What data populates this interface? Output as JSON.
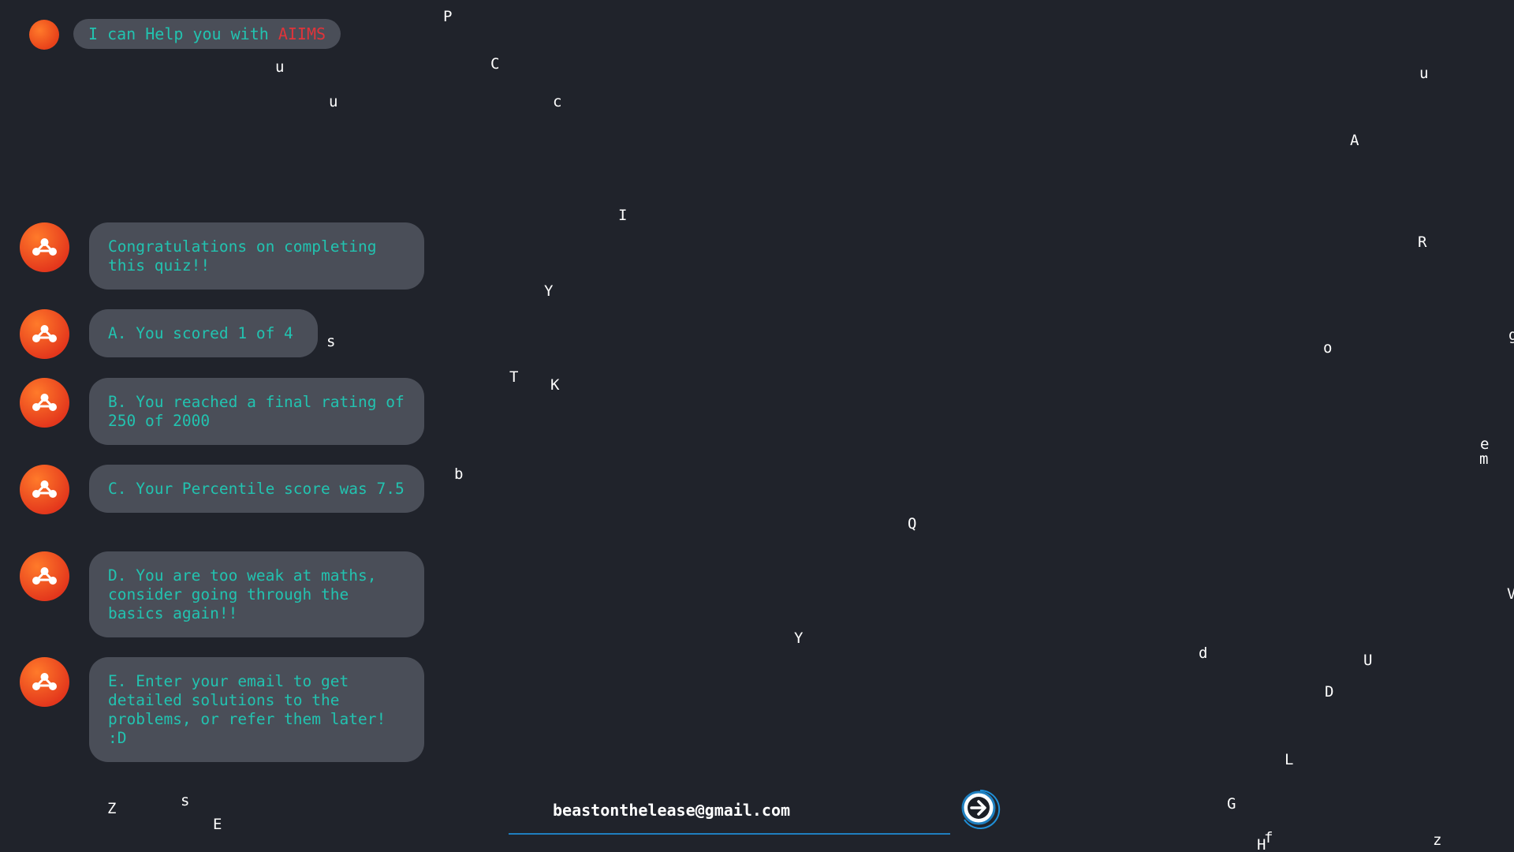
{
  "header": {
    "label_prefix": "I can Help you with ",
    "label_highlight": "AIIMS"
  },
  "messages": [
    {
      "text": "Congratulations on completing this quiz!!"
    },
    {
      "text": "A. You scored 1 of 4"
    },
    {
      "text": "B. You reached a final rating of 250 of 2000"
    },
    {
      "text": "C. Your Percentile score was 7.5"
    },
    {
      "text": "D. You are too weak at maths, consider going through the basics again!!"
    },
    {
      "text": "E. Enter your email to get detailed solutions to the problems, or refer them later! :D"
    }
  ],
  "email_input": {
    "value": "beastonthelease@gmail.com"
  },
  "scatter_letters": [
    "P",
    "C",
    "u",
    "u",
    "c",
    "u",
    "A",
    "I",
    "R",
    "Y",
    "o",
    "g",
    "s",
    "T",
    "K",
    "b",
    "e",
    "m",
    "Q",
    "V",
    "Y",
    "d",
    "U",
    "D",
    "L",
    "G",
    "Z",
    "s",
    "E",
    "f",
    "H",
    "z"
  ],
  "colors": {
    "background": "#20232b",
    "bubble": "#4a4e58",
    "bubble_text": "#22c3b0",
    "highlight": "#e0343a",
    "accent": "#e8421a",
    "input_underline": "#1f7fbf"
  },
  "icons": {
    "avatar": "network-nodes-icon",
    "send": "arrow-right-circle-icon"
  }
}
